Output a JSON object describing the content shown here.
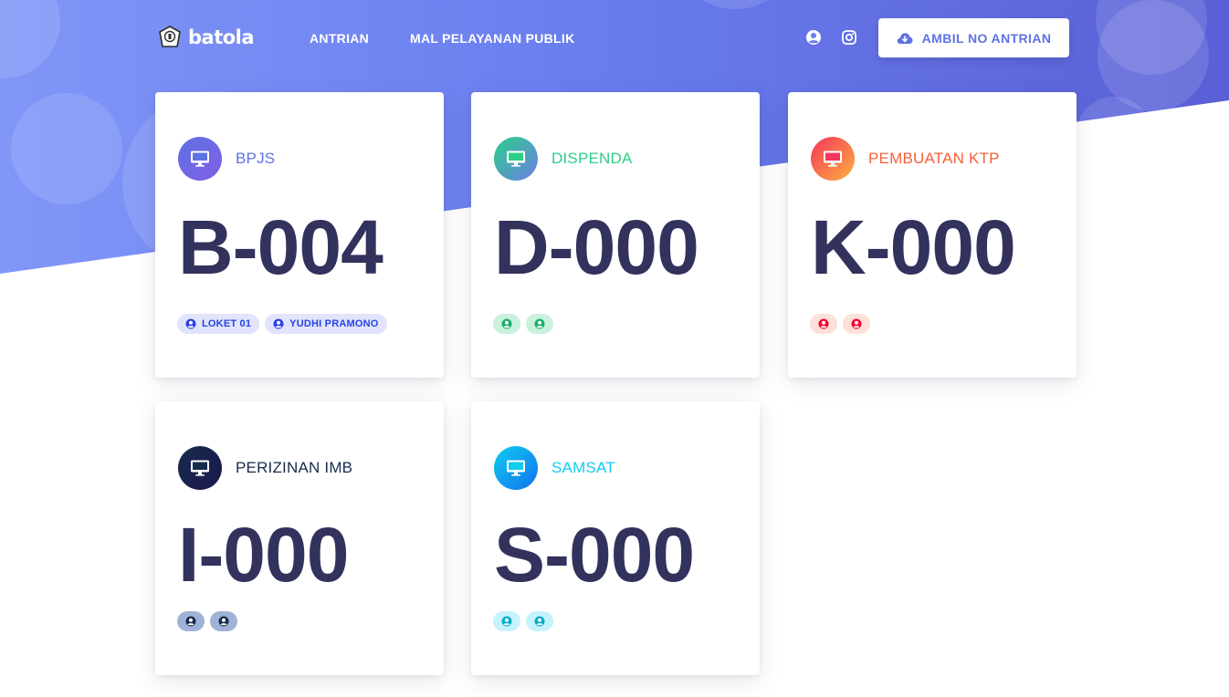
{
  "brand": {
    "name": "batola"
  },
  "nav": {
    "links": [
      "ANTRIAN",
      "MAL PELAYANAN PUBLIK"
    ],
    "icons": [
      "user-circle-icon",
      "instagram-icon"
    ],
    "cta_label": "AMBIL NO ANTRIAN",
    "cta_icon": "cloud-download-icon"
  },
  "colors": {
    "hero_gradient": [
      "#8196f7",
      "#5a5fd6"
    ],
    "ticket_text": "#32325d",
    "accent": "#5e72e4"
  },
  "cards": [
    {
      "service": "BPJS",
      "ticket": "B-004",
      "icon": "desktop-icon",
      "name_color": "#5e72e4",
      "icon_gradient": [
        "#5e72e4",
        "#825ee4"
      ],
      "pill_bg": "#e1e4fb",
      "pill_color": "#2643e9",
      "pills": [
        {
          "icon": "user-circle-icon",
          "label": "LOKET 01"
        },
        {
          "icon": "user-circle-icon",
          "label": "YUDHI PRAMONO"
        }
      ]
    },
    {
      "service": "DISPENDA",
      "ticket": "D-000",
      "icon": "desktop-icon",
      "name_color": "#2dce89",
      "icon_gradient": [
        "#2dce89",
        "#6a7fe6"
      ],
      "pill_bg": "#c9f2dd",
      "pill_color": "#1aae6f",
      "pills": [
        {
          "icon": "user-circle-icon",
          "label": ""
        },
        {
          "icon": "user-circle-icon",
          "label": ""
        }
      ]
    },
    {
      "service": "PEMBUATAN KTP",
      "ticket": "K-000",
      "icon": "desktop-icon",
      "name_color": "#f5603a",
      "icon_gradient": [
        "#f5365c",
        "#fbb140"
      ],
      "pill_bg": "#fde0d8",
      "pill_color": "#f80031",
      "pills": [
        {
          "icon": "user-circle-icon",
          "label": ""
        },
        {
          "icon": "user-circle-icon",
          "label": ""
        }
      ]
    },
    {
      "service": "PERIZINAN IMB",
      "ticket": "I-000",
      "icon": "desktop-icon",
      "name_color": "#172b4d",
      "icon_gradient": [
        "#172b4d",
        "#1a174d"
      ],
      "pill_bg": "#9fb3d6",
      "pill_color": "#172b4d",
      "pills": [
        {
          "icon": "user-circle-icon",
          "label": ""
        },
        {
          "icon": "user-circle-icon",
          "label": ""
        }
      ]
    },
    {
      "service": "SAMSAT",
      "ticket": "S-000",
      "icon": "desktop-icon",
      "name_color": "#11cdef",
      "icon_gradient": [
        "#11cdef",
        "#1171ef"
      ],
      "pill_bg": "#c6f2fb",
      "pill_color": "#03acca",
      "pills": [
        {
          "icon": "user-circle-icon",
          "label": ""
        },
        {
          "icon": "user-circle-icon",
          "label": ""
        }
      ]
    }
  ]
}
